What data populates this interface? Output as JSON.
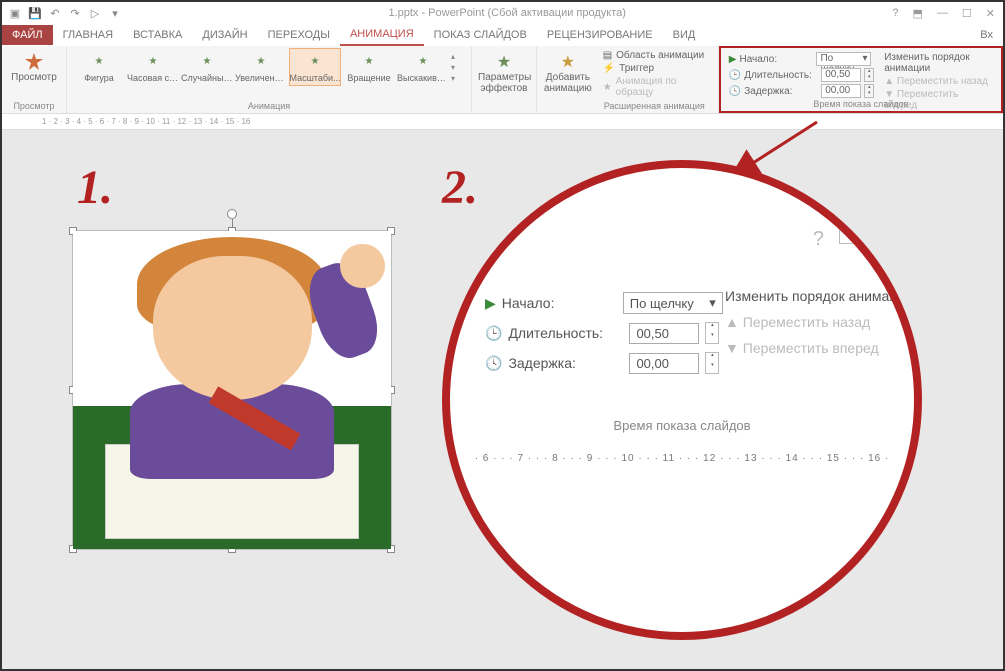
{
  "title": "1.pptx - PowerPoint (Сбой активации продукта)",
  "qat_icons": [
    "save-icon",
    "undo-icon",
    "redo-icon",
    "start-icon"
  ],
  "window_icons": [
    "help",
    "min",
    "max",
    "close"
  ],
  "tabs": {
    "file": "ФАЙЛ",
    "items": [
      "ГЛАВНАЯ",
      "ВСТАВКА",
      "ДИЗАЙН",
      "ПЕРЕХОДЫ",
      "АНИМАЦИЯ",
      "ПОКАЗ СЛАЙДОВ",
      "РЕЦЕНЗИРОВАНИЕ",
      "ВИД"
    ],
    "active_index": 4
  },
  "ribbon": {
    "preview": {
      "label": "Просмотр",
      "group": "Просмотр"
    },
    "gallery": [
      {
        "label": "Фигура"
      },
      {
        "label": "Часовая ст..."
      },
      {
        "label": "Случайные..."
      },
      {
        "label": "Увеличени..."
      },
      {
        "label": "Масштаби..."
      },
      {
        "label": "Вращение"
      },
      {
        "label": "Выскакива..."
      }
    ],
    "gallery_group": "Анимация",
    "effects": "Параметры эффектов",
    "add": "Добавить анимацию",
    "adv": {
      "pane": "Область анимации",
      "trigger": "Триггер",
      "painter": "Анимация по образцу",
      "group": "Расширенная анимация"
    },
    "timing": {
      "start_lbl": "Начало:",
      "start_val": "По щелчку",
      "duration_lbl": "Длительность:",
      "duration_val": "00,50",
      "delay_lbl": "Задержка:",
      "delay_val": "00,00",
      "reorder": "Изменить порядок анимации",
      "back": "Переместить назад",
      "fwd": "Переместить вперед",
      "group": "Время показа слайдов"
    }
  },
  "ruler_ticks": "1 · 2 · 3 · 4 · 5 · 6 · 7 · 8 · 9 · 10 · 11 · 12 · 13 · 14 · 15 · 16",
  "callouts": {
    "one": "1.",
    "two": "2."
  },
  "zoom_ruler": "· 6 · · · 7 · · · 8 · · · 9 · · · 10 · · · 11 · · · 12 · · · 13 · · · 14 · · · 15 · · · 16 ·",
  "login": "Вх"
}
